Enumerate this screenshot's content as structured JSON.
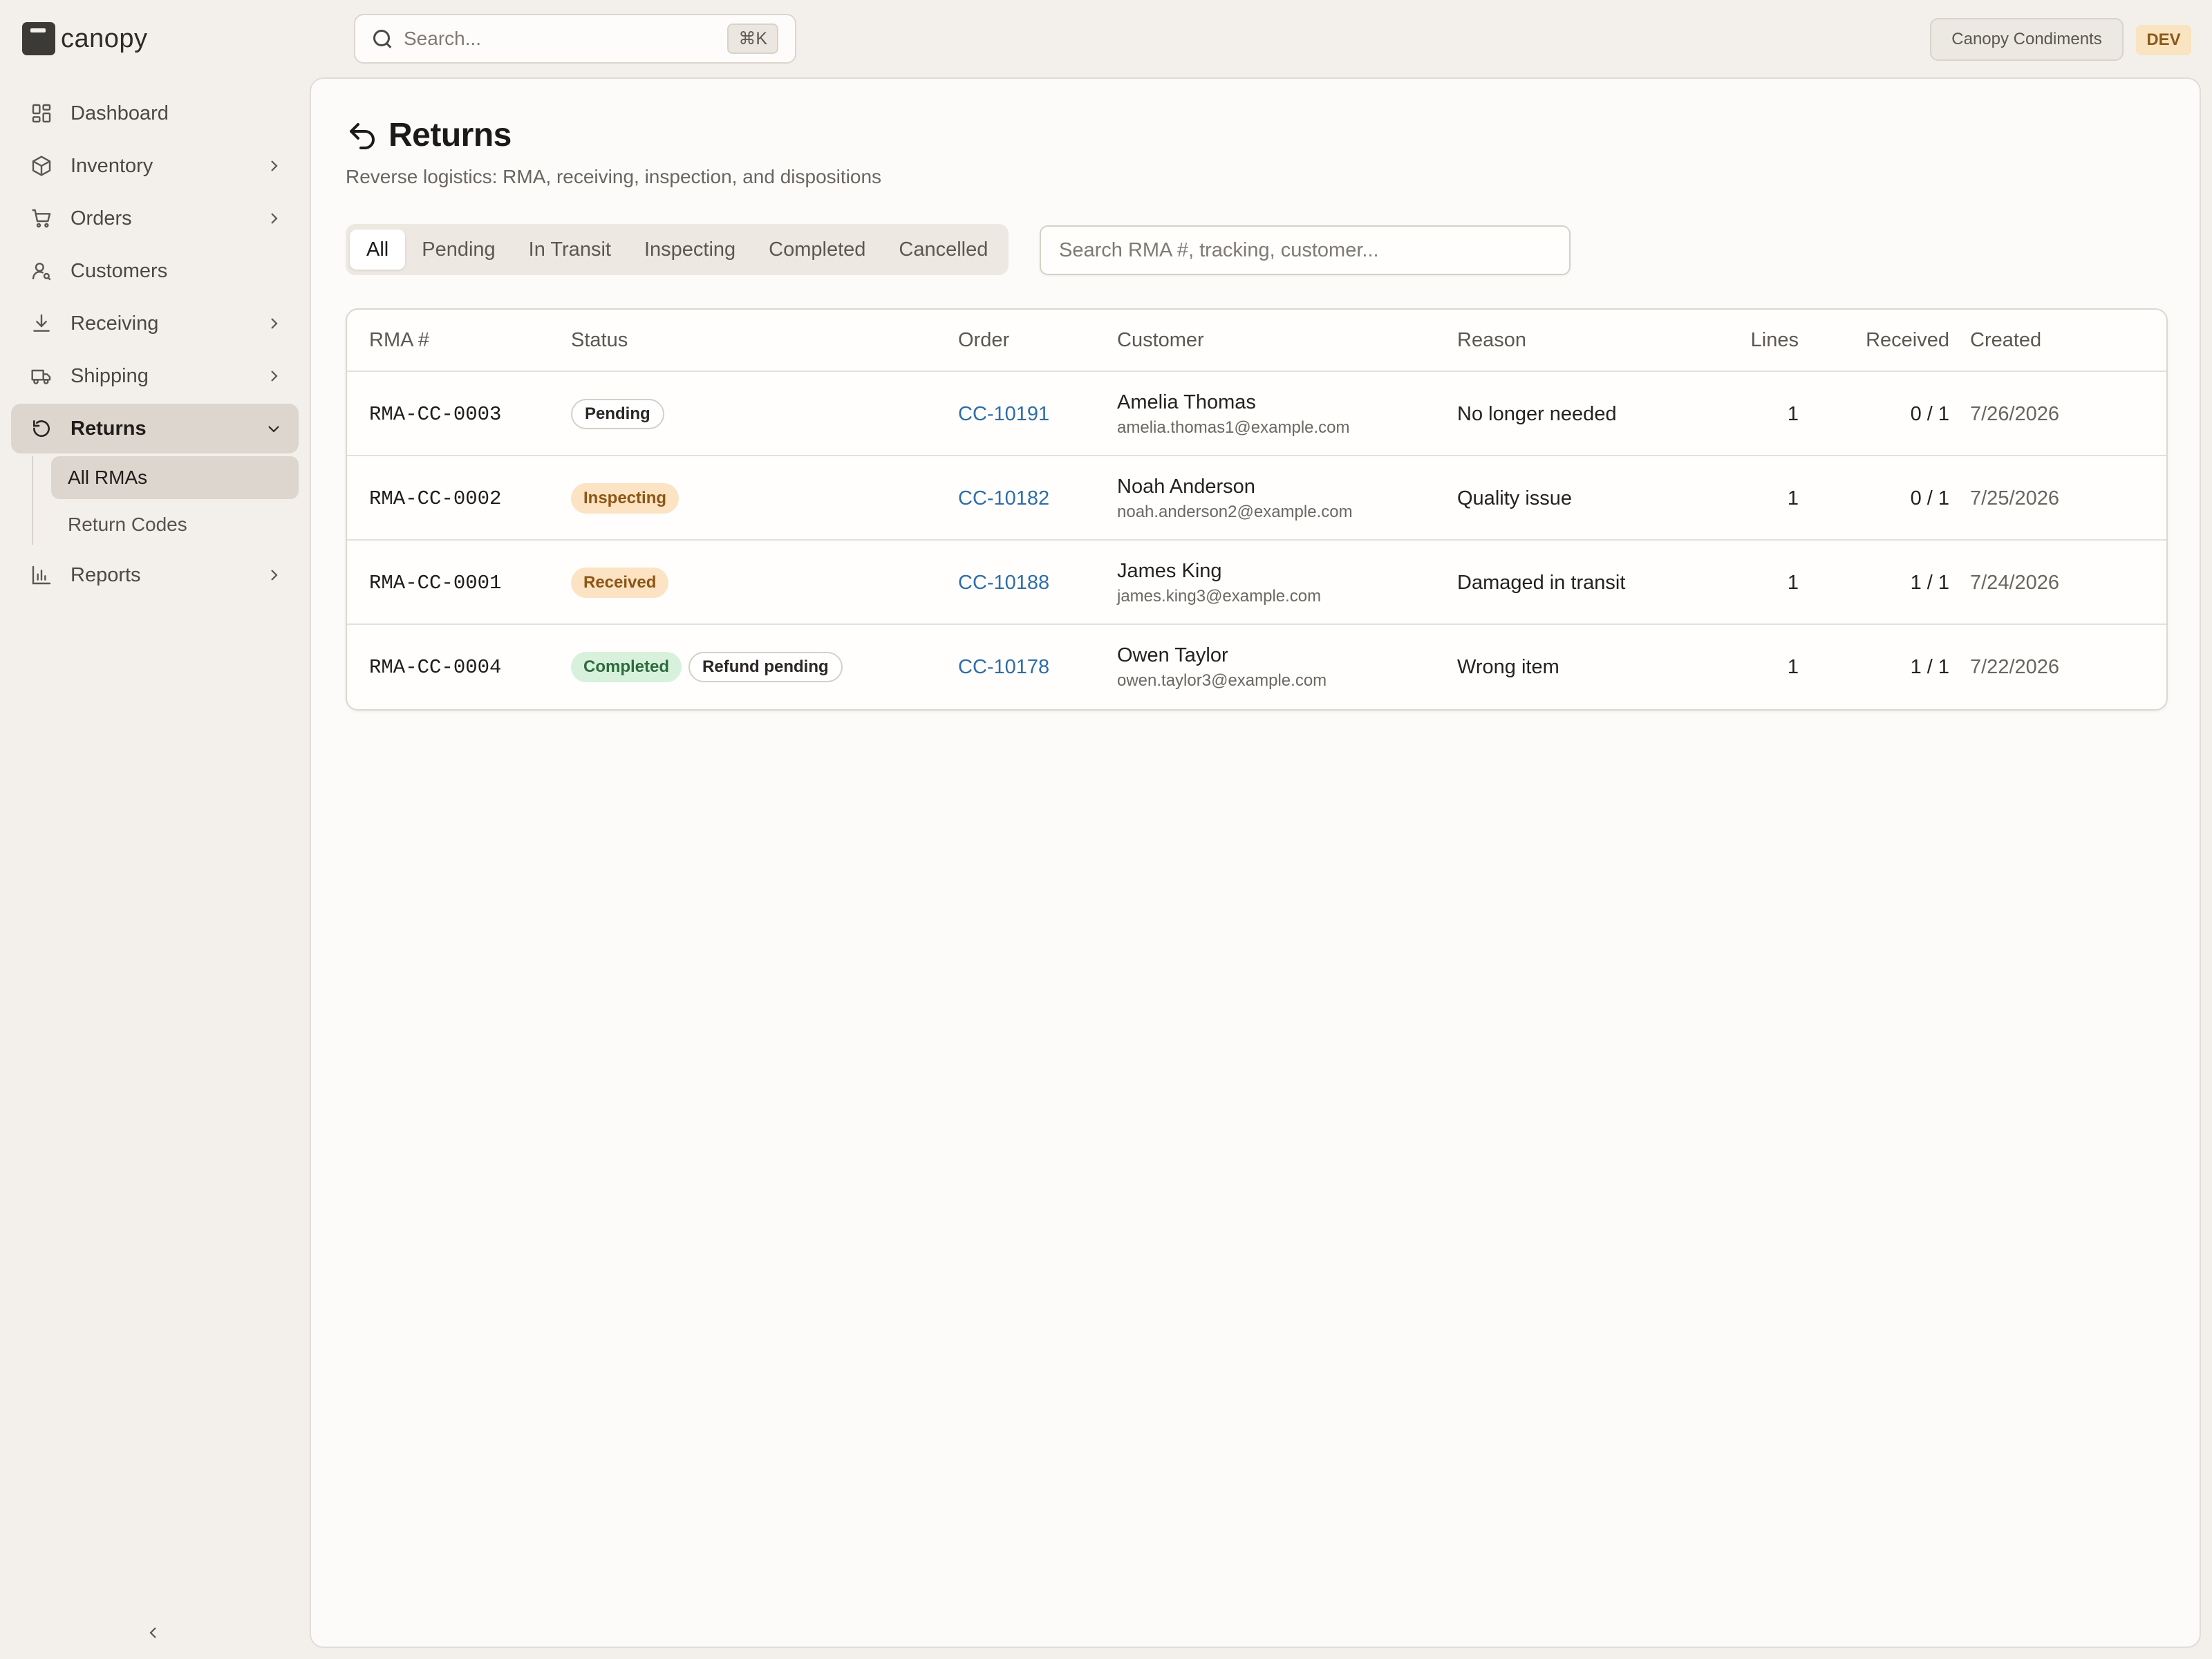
{
  "app": {
    "name": "canopy",
    "org": "Canopy Condiments",
    "env": "DEV"
  },
  "search": {
    "placeholder": "Search...",
    "shortcut": "⌘K"
  },
  "sidebar": {
    "items": [
      {
        "label": "Dashboard",
        "icon": "dashboard-icon"
      },
      {
        "label": "Inventory",
        "icon": "box-icon"
      },
      {
        "label": "Orders",
        "icon": "cart-icon"
      },
      {
        "label": "Customers",
        "icon": "users-icon"
      },
      {
        "label": "Receiving",
        "icon": "download-icon"
      },
      {
        "label": "Shipping",
        "icon": "truck-icon"
      },
      {
        "label": "Returns",
        "icon": "return-icon"
      },
      {
        "label": "Reports",
        "icon": "bar-chart-icon"
      }
    ],
    "returns_sub": [
      "All RMAs",
      "Return Codes"
    ]
  },
  "page": {
    "title": "Returns",
    "subtitle": "Reverse logistics: RMA, receiving, inspection, and dispositions",
    "tabs": [
      "All",
      "Pending",
      "In Transit",
      "Inspecting",
      "Completed",
      "Cancelled"
    ],
    "filter_placeholder": "Search RMA #, tracking, customer..."
  },
  "table": {
    "columns": [
      "RMA #",
      "Status",
      "Order",
      "Customer",
      "Reason",
      "Lines",
      "Received",
      "Created"
    ],
    "rows": [
      {
        "rma": "RMA-CC-0003",
        "status": "Pending",
        "extra": "",
        "order": "CC-10191",
        "customer": "Amelia Thomas",
        "email": "amelia.thomas1@example.com",
        "reason": "No longer needed",
        "lines": "1",
        "received": "0 / 1",
        "created": "7/26/2026"
      },
      {
        "rma": "RMA-CC-0002",
        "status": "Inspecting",
        "extra": "",
        "order": "CC-10182",
        "customer": "Noah Anderson",
        "email": "noah.anderson2@example.com",
        "reason": "Quality issue",
        "lines": "1",
        "received": "0 / 1",
        "created": "7/25/2026"
      },
      {
        "rma": "RMA-CC-0001",
        "status": "Received",
        "extra": "",
        "order": "CC-10188",
        "customer": "James King",
        "email": "james.king3@example.com",
        "reason": "Damaged in transit",
        "lines": "1",
        "received": "1 / 1",
        "created": "7/24/2026"
      },
      {
        "rma": "RMA-CC-0004",
        "status": "Completed",
        "extra": "Refund pending",
        "order": "CC-10178",
        "customer": "Owen Taylor",
        "email": "owen.taylor3@example.com",
        "reason": "Wrong item",
        "lines": "1",
        "received": "1 / 1",
        "created": "7/22/2026"
      }
    ]
  },
  "colors": {
    "accent_link": "#2d6ea8",
    "pending_badge": "#ffffff",
    "amber_badge": "#fbe3c4",
    "green_badge": "#d7f1dc",
    "env_badge": "#f9e3c0"
  }
}
